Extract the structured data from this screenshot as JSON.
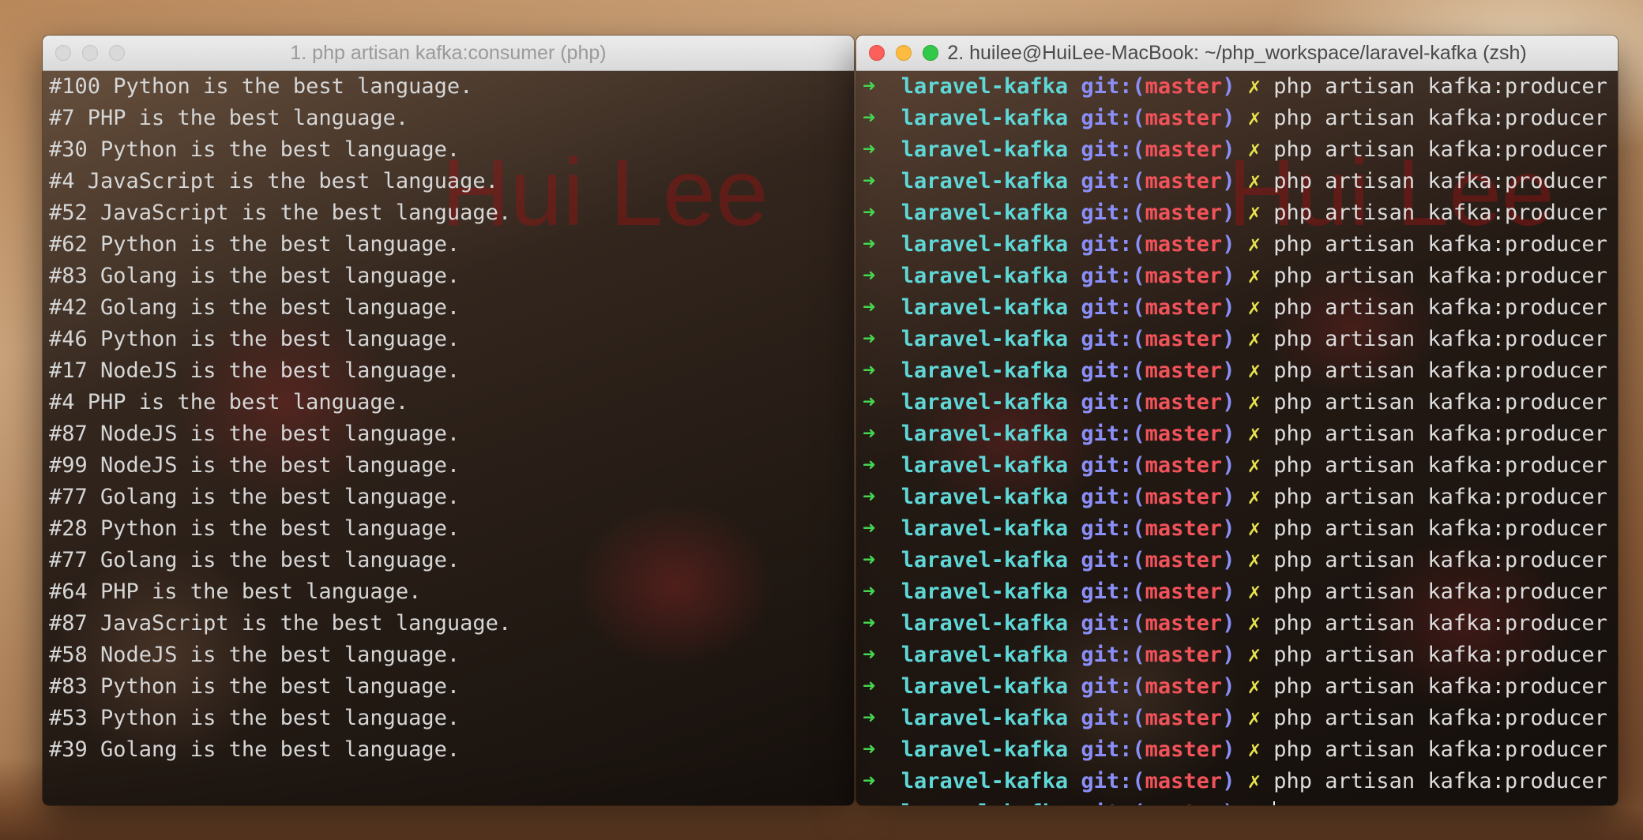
{
  "left_window": {
    "title": "1. php artisan kafka:consumer (php)",
    "watermark": "Hui Lee",
    "lines": [
      "#100 Python is the best language.",
      "#7 PHP is the best language.",
      "#30 Python is the best language.",
      "#4 JavaScript is the best language.",
      "#52 JavaScript is the best language.",
      "#62 Python is the best language.",
      "#83 Golang is the best language.",
      "#42 Golang is the best language.",
      "#46 Python is the best language.",
      "#17 NodeJS is the best language.",
      "#4 PHP is the best language.",
      "#87 NodeJS is the best language.",
      "#99 NodeJS is the best language.",
      "#77 Golang is the best language.",
      "#28 Python is the best language.",
      "#77 Golang is the best language.",
      "#64 PHP is the best language.",
      "#87 JavaScript is the best language.",
      "#58 NodeJS is the best language.",
      "#83 Python is the best language.",
      "#53 Python is the best language.",
      "#39 Golang is the best language."
    ]
  },
  "right_window": {
    "title": "2. huilee@HuiLee-MacBook: ~/php_workspace/laravel-kafka (zsh)",
    "watermark": "Hui Lee",
    "prompt": {
      "arrow": "➜",
      "dir": "laravel-kafka",
      "git_prefix": "git:(",
      "branch": "master",
      "git_suffix": ")",
      "dirty": "✗"
    },
    "command": "php artisan kafka:producer",
    "command_line_count": 23
  },
  "colors": {
    "arrow": "#45d64f",
    "dir": "#5fd7d7",
    "git": "#8a8ff8",
    "branch": "#f2535a",
    "dirty": "#e7e24d"
  }
}
